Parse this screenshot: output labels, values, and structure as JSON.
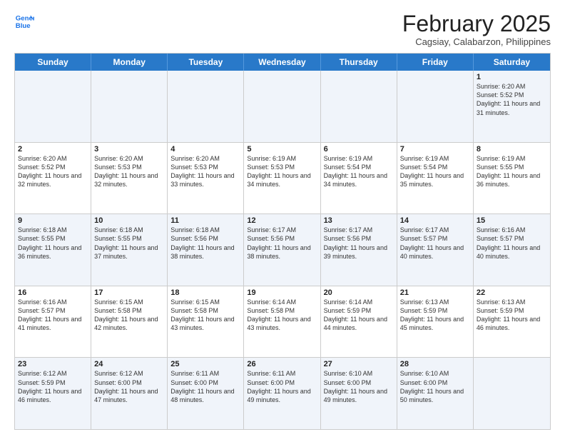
{
  "header": {
    "logo_line1": "General",
    "logo_line2": "Blue",
    "month": "February 2025",
    "location": "Cagsiay, Calabarzon, Philippines"
  },
  "days_of_week": [
    "Sunday",
    "Monday",
    "Tuesday",
    "Wednesday",
    "Thursday",
    "Friday",
    "Saturday"
  ],
  "weeks": [
    [
      {
        "day": "",
        "info": ""
      },
      {
        "day": "",
        "info": ""
      },
      {
        "day": "",
        "info": ""
      },
      {
        "day": "",
        "info": ""
      },
      {
        "day": "",
        "info": ""
      },
      {
        "day": "",
        "info": ""
      },
      {
        "day": "1",
        "info": "Sunrise: 6:20 AM\nSunset: 5:52 PM\nDaylight: 11 hours and 31 minutes."
      }
    ],
    [
      {
        "day": "2",
        "info": "Sunrise: 6:20 AM\nSunset: 5:52 PM\nDaylight: 11 hours and 32 minutes."
      },
      {
        "day": "3",
        "info": "Sunrise: 6:20 AM\nSunset: 5:53 PM\nDaylight: 11 hours and 32 minutes."
      },
      {
        "day": "4",
        "info": "Sunrise: 6:20 AM\nSunset: 5:53 PM\nDaylight: 11 hours and 33 minutes."
      },
      {
        "day": "5",
        "info": "Sunrise: 6:19 AM\nSunset: 5:53 PM\nDaylight: 11 hours and 34 minutes."
      },
      {
        "day": "6",
        "info": "Sunrise: 6:19 AM\nSunset: 5:54 PM\nDaylight: 11 hours and 34 minutes."
      },
      {
        "day": "7",
        "info": "Sunrise: 6:19 AM\nSunset: 5:54 PM\nDaylight: 11 hours and 35 minutes."
      },
      {
        "day": "8",
        "info": "Sunrise: 6:19 AM\nSunset: 5:55 PM\nDaylight: 11 hours and 36 minutes."
      }
    ],
    [
      {
        "day": "9",
        "info": "Sunrise: 6:18 AM\nSunset: 5:55 PM\nDaylight: 11 hours and 36 minutes."
      },
      {
        "day": "10",
        "info": "Sunrise: 6:18 AM\nSunset: 5:55 PM\nDaylight: 11 hours and 37 minutes."
      },
      {
        "day": "11",
        "info": "Sunrise: 6:18 AM\nSunset: 5:56 PM\nDaylight: 11 hours and 38 minutes."
      },
      {
        "day": "12",
        "info": "Sunrise: 6:17 AM\nSunset: 5:56 PM\nDaylight: 11 hours and 38 minutes."
      },
      {
        "day": "13",
        "info": "Sunrise: 6:17 AM\nSunset: 5:56 PM\nDaylight: 11 hours and 39 minutes."
      },
      {
        "day": "14",
        "info": "Sunrise: 6:17 AM\nSunset: 5:57 PM\nDaylight: 11 hours and 40 minutes."
      },
      {
        "day": "15",
        "info": "Sunrise: 6:16 AM\nSunset: 5:57 PM\nDaylight: 11 hours and 40 minutes."
      }
    ],
    [
      {
        "day": "16",
        "info": "Sunrise: 6:16 AM\nSunset: 5:57 PM\nDaylight: 11 hours and 41 minutes."
      },
      {
        "day": "17",
        "info": "Sunrise: 6:15 AM\nSunset: 5:58 PM\nDaylight: 11 hours and 42 minutes."
      },
      {
        "day": "18",
        "info": "Sunrise: 6:15 AM\nSunset: 5:58 PM\nDaylight: 11 hours and 43 minutes."
      },
      {
        "day": "19",
        "info": "Sunrise: 6:14 AM\nSunset: 5:58 PM\nDaylight: 11 hours and 43 minutes."
      },
      {
        "day": "20",
        "info": "Sunrise: 6:14 AM\nSunset: 5:59 PM\nDaylight: 11 hours and 44 minutes."
      },
      {
        "day": "21",
        "info": "Sunrise: 6:13 AM\nSunset: 5:59 PM\nDaylight: 11 hours and 45 minutes."
      },
      {
        "day": "22",
        "info": "Sunrise: 6:13 AM\nSunset: 5:59 PM\nDaylight: 11 hours and 46 minutes."
      }
    ],
    [
      {
        "day": "23",
        "info": "Sunrise: 6:12 AM\nSunset: 5:59 PM\nDaylight: 11 hours and 46 minutes."
      },
      {
        "day": "24",
        "info": "Sunrise: 6:12 AM\nSunset: 6:00 PM\nDaylight: 11 hours and 47 minutes."
      },
      {
        "day": "25",
        "info": "Sunrise: 6:11 AM\nSunset: 6:00 PM\nDaylight: 11 hours and 48 minutes."
      },
      {
        "day": "26",
        "info": "Sunrise: 6:11 AM\nSunset: 6:00 PM\nDaylight: 11 hours and 49 minutes."
      },
      {
        "day": "27",
        "info": "Sunrise: 6:10 AM\nSunset: 6:00 PM\nDaylight: 11 hours and 49 minutes."
      },
      {
        "day": "28",
        "info": "Sunrise: 6:10 AM\nSunset: 6:00 PM\nDaylight: 11 hours and 50 minutes."
      },
      {
        "day": "",
        "info": ""
      }
    ]
  ]
}
